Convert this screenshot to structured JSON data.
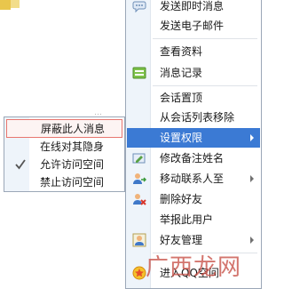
{
  "main_menu": {
    "items": [
      {
        "label": "发送即时消息",
        "icon": "chat-bubble-icon"
      },
      {
        "label": "发送电子邮件",
        "icon": "email-icon"
      },
      {
        "label": "查看资料",
        "icon": "profile-icon"
      },
      {
        "label": "消息记录",
        "icon": "message-log-icon"
      },
      {
        "label": "会话置顶",
        "icon": "pin-icon"
      },
      {
        "label": "从会话列表移除",
        "icon": "remove-icon"
      },
      {
        "label": "设置权限",
        "icon": "permission-icon",
        "submenu": true,
        "active": true
      },
      {
        "label": "修改备注姓名",
        "icon": "edit-name-icon"
      },
      {
        "label": "移动联系人至",
        "icon": "move-contact-icon",
        "submenu": true
      },
      {
        "label": "删除好友",
        "icon": "delete-friend-icon"
      },
      {
        "label": "举报此用户",
        "icon": "report-icon"
      },
      {
        "label": "好友管理",
        "icon": "friend-manage-icon",
        "submenu": true
      },
      {
        "label": "进入QQ空间",
        "icon": "qzone-icon"
      }
    ]
  },
  "submenu": {
    "items": [
      {
        "label": "屏蔽此人消息",
        "highlighted": true
      },
      {
        "label": "在线对其隐身"
      },
      {
        "label": "允许访问空间",
        "checked": true
      },
      {
        "label": "禁止访问空间"
      }
    ]
  },
  "background": {
    "fragment_text": "…"
  },
  "watermark": {
    "text": "广西龙网"
  },
  "colors": {
    "accent": "#3b7ad4",
    "highlight_border": "#e8766f",
    "menu_border": "#9ba7b7"
  }
}
